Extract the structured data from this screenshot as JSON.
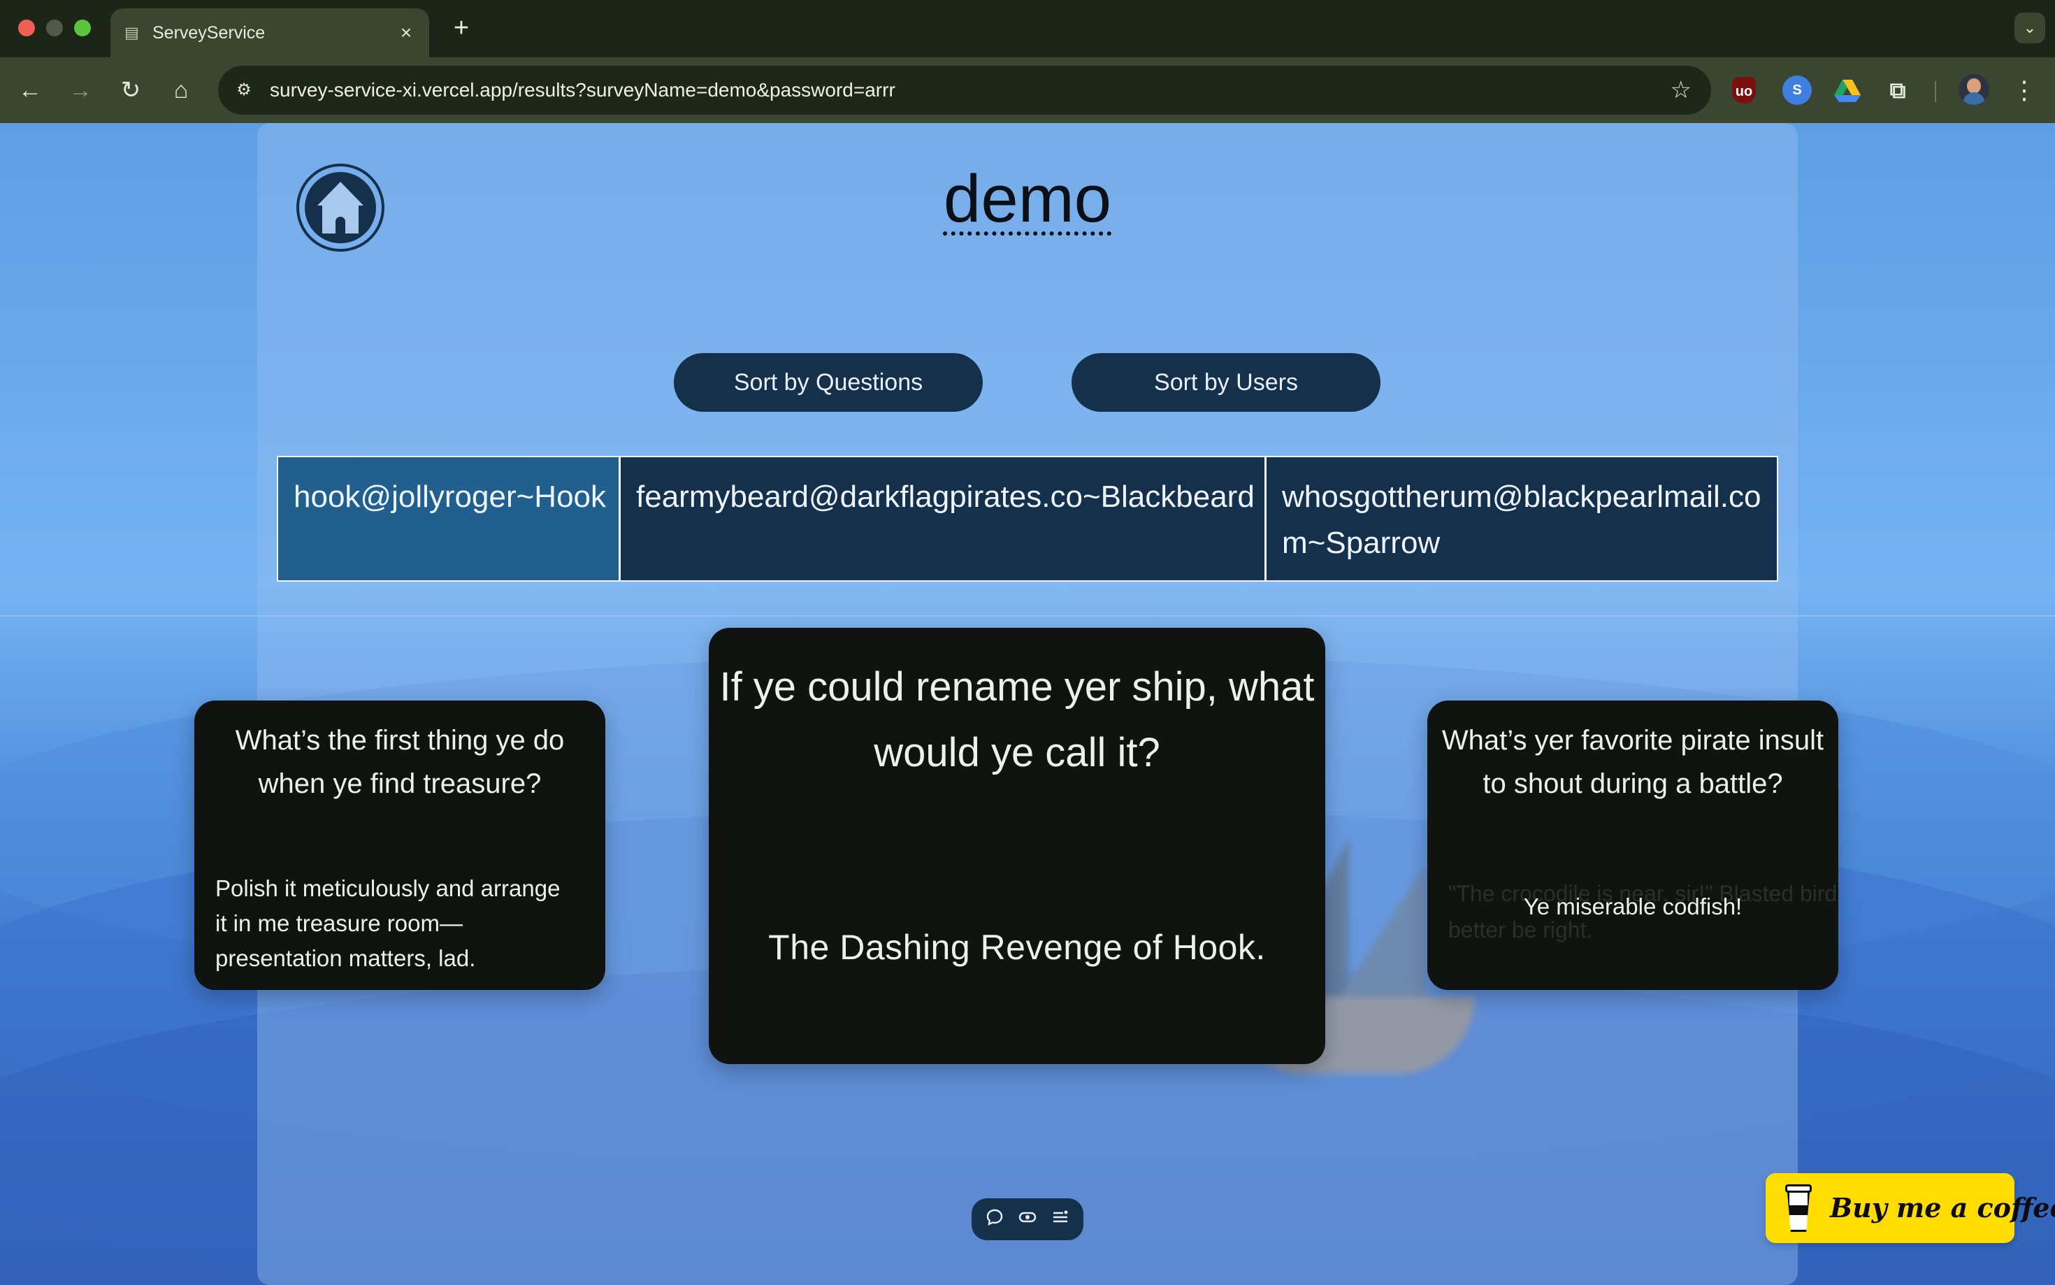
{
  "browser": {
    "tab_title": "ServeyService",
    "tab_close": "×",
    "new_tab": "+",
    "url": "survey-service-xi.vercel.app/results?surveyName=demo&password=arrr"
  },
  "page": {
    "title": "demo",
    "sort_questions_label": "Sort by Questions",
    "sort_users_label": "Sort by Users",
    "users": [
      {
        "label": "hook@jollyroger~Hook",
        "active": true
      },
      {
        "label": "fearmybeard@darkflagpirates.co~Blackbeard",
        "active": false
      },
      {
        "label": "whosgottherum@blackpearlmail.com~Sparrow",
        "active": false
      }
    ],
    "cards": {
      "left": {
        "question": "What’s the first thing ye do when ye find treasure?",
        "answer": "Polish it meticulously and arrange it in me treasure room—presentation matters, lad."
      },
      "center": {
        "question": "If ye could rename yer ship, what would ye call it?",
        "answer": "The Dashing Revenge of Hook."
      },
      "right": {
        "question": "What’s yer favorite pirate insult to shout during a battle?",
        "answer": "Ye miserable codfish!",
        "ghost_answer": "\"The crocodile is near, sir!\" Blasted bird better be right."
      }
    },
    "coffee_label": "Buy me a coffee"
  },
  "icons": {
    "home": "home-icon",
    "comment": "comment-icon",
    "eye": "eye-icon",
    "list": "list-icon"
  },
  "colors": {
    "navy": "#14304b",
    "active_user": "#215f8e",
    "card_bg": "#101310",
    "coffee_yellow": "#ffdd00"
  }
}
